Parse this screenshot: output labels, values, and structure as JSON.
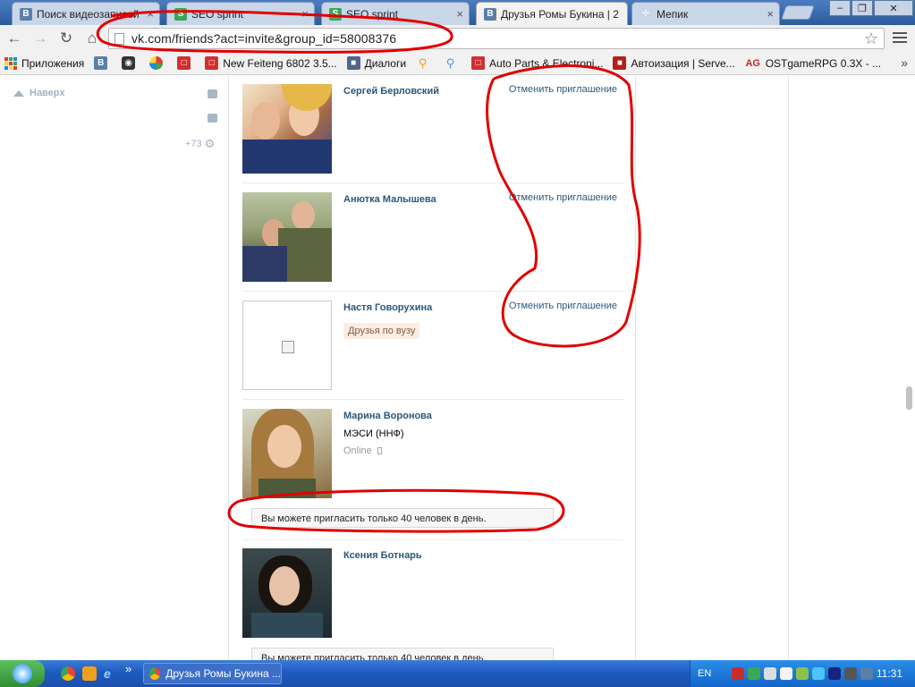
{
  "browser": {
    "tabs": [
      {
        "title": "Поиск видеозаписей",
        "icon": "vk-icon",
        "active": false
      },
      {
        "title": "SEO sprint",
        "icon": "seosprint-icon",
        "active": false
      },
      {
        "title": "SEO sprint",
        "icon": "seosprint-icon",
        "active": false
      },
      {
        "title": "Друзья Ромы Букина | 2",
        "icon": "vk-icon",
        "active": true
      },
      {
        "title": "Мепик",
        "icon": "mepik-icon",
        "active": false
      }
    ],
    "close_glyph": "×",
    "url": "vk.com/friends?act=invite&group_id=58008376",
    "window_controls": {
      "minimize": "–",
      "maximize": "❐",
      "close": "✕"
    }
  },
  "bookmarks": {
    "items": [
      {
        "label": "Приложения",
        "icon": "apps-icon"
      },
      {
        "label": "",
        "icon": "vk-icon"
      },
      {
        "label": "",
        "icon": "camera-icon"
      },
      {
        "label": "",
        "icon": "picasa-icon"
      },
      {
        "label": "",
        "icon": "cart-icon"
      },
      {
        "label": "New Feiteng 6802 3.5...",
        "icon": "cart-icon"
      },
      {
        "label": "Диалоги",
        "icon": "speech-bubble-icon"
      },
      {
        "label": "",
        "icon": "map-pin-icon"
      },
      {
        "label": "",
        "icon": "map-pin-icon"
      },
      {
        "label": "Auto Parts & Electroni...",
        "icon": "cart-icon"
      },
      {
        "label": "Автоизация | Serve...",
        "icon": "serve-icon"
      },
      {
        "label": "OSTgameRPG 0.3X - ...",
        "icon": "ag-icon"
      }
    ],
    "vk_letter": "В",
    "ag_letter": "AG",
    "more": "»"
  },
  "sidebar": {
    "to_top": "Наверх",
    "count": "+73"
  },
  "friends": [
    {
      "name": "Сергей Берловский",
      "action": "Отменить приглашение"
    },
    {
      "name": "Анютка Малышева",
      "action": "Отменить приглашение"
    },
    {
      "name": "Настя Говорухина",
      "action": "Отменить приглашение",
      "tag": "Друзья по вузу"
    },
    {
      "name": "Марина Воронова",
      "university": "МЭСИ (ННФ)",
      "status": "Online",
      "notice": "Вы можете пригласить только 40 человек в день."
    },
    {
      "name": "Ксения Ботнарь",
      "notice": "Вы можете пригласить только 40 человек в день."
    }
  ],
  "taskbar": {
    "window_title": "Друзья Ромы Букина ...",
    "language": "EN",
    "clock": "11:31",
    "overflow": "»"
  },
  "colors": {
    "link": "#2b587a",
    "annotation": "#e00000"
  }
}
